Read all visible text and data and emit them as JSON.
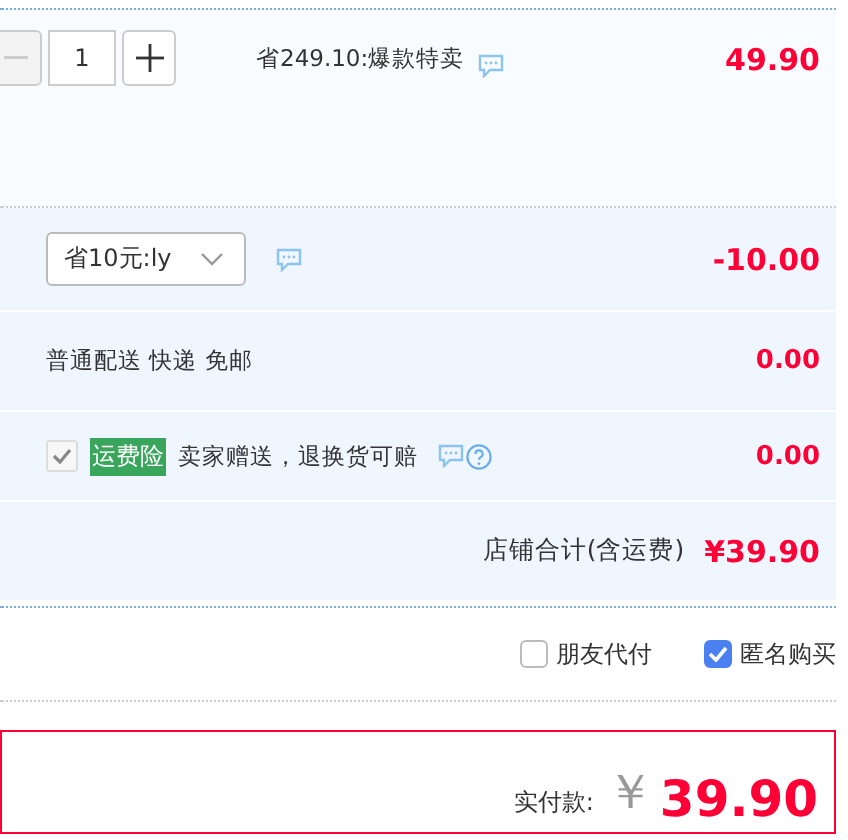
{
  "item": {
    "quantity": "1",
    "minus_disabled": true,
    "promo": "省249.10:爆款特卖",
    "price": "49.90"
  },
  "coupon": {
    "value": "省10元:ly",
    "amount": "-10.00"
  },
  "shipping": {
    "label": "普通配送 快递 免邮",
    "amount": "0.00"
  },
  "insurance": {
    "checked": true,
    "disabled": true,
    "tag": "运费险",
    "text": "卖家赠送，退换货可赔",
    "amount": "0.00"
  },
  "store_total": {
    "label": "店铺合计(含运费)",
    "amount": "¥39.90"
  },
  "options": [
    {
      "label": "朋友代付",
      "checked": false
    },
    {
      "label": "匿名购买",
      "checked": true
    }
  ],
  "payment": {
    "label": "实付款:",
    "currency": "￥",
    "amount": "39.90"
  }
}
